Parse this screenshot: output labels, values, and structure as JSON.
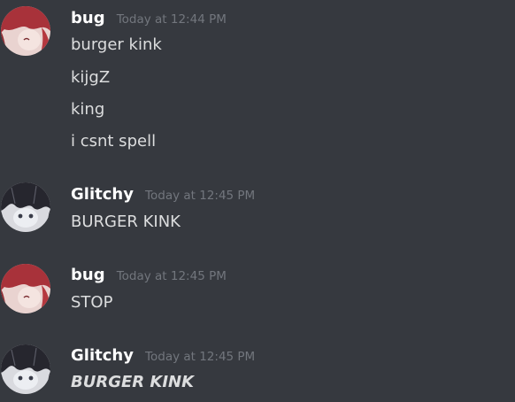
{
  "messages": [
    {
      "author": "bug",
      "timestamp": "Today at 12:44 PM",
      "avatar": "bug-avatar-red-hair",
      "lines": [
        "burger kink",
        "kijgZ",
        "king",
        "i csnt spell"
      ]
    },
    {
      "author": "Glitchy",
      "timestamp": "Today at 12:45 PM",
      "avatar": "glitchy-avatar-dark-hair",
      "lines": [
        "BURGER KINK"
      ]
    },
    {
      "author": "bug",
      "timestamp": "Today at 12:45 PM",
      "avatar": "bug-avatar-red-hair",
      "lines": [
        "STOP"
      ]
    },
    {
      "author": "Glitchy",
      "timestamp": "Today at 12:45 PM",
      "avatar": "glitchy-avatar-dark-hair",
      "lines": [
        "BURGER KINK"
      ],
      "emphasis": "bold-italic"
    }
  ],
  "colors": {
    "background": "#36393f",
    "username": "#ffffff",
    "timestamp": "#72767d",
    "message_text": "#dcddde"
  }
}
